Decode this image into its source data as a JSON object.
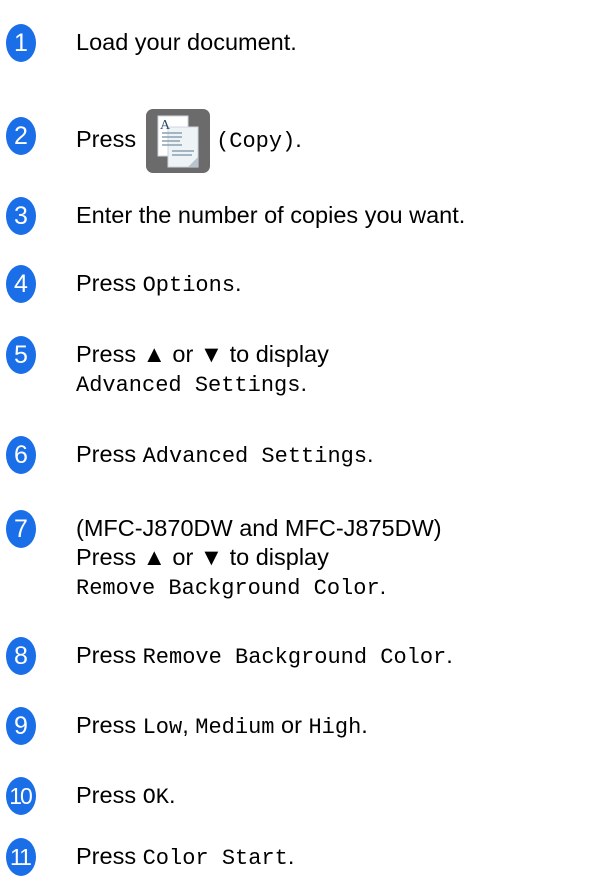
{
  "steps": [
    {
      "num": "1",
      "text": "Load your document."
    },
    {
      "num": "2",
      "text_before": "Press",
      "icon_label": "A",
      "code": "(Copy)",
      "text_after": "."
    },
    {
      "num": "3",
      "text": "Enter the number of copies you want."
    },
    {
      "num": "4",
      "text_before": "Press",
      "code": "Options",
      "text_after": "."
    },
    {
      "num": "5",
      "line1": "Press ▲ or ▼ to display",
      "code": "Advanced Settings",
      "text_after": "."
    },
    {
      "num": "6",
      "text_before": "Press",
      "code": "Advanced Settings",
      "text_after": "."
    },
    {
      "num": "7",
      "line1": "(MFC-J870DW and MFC-J875DW)",
      "line2": "Press ▲ or ▼ to display",
      "code": "Remove Background Color",
      "text_after": "."
    },
    {
      "num": "8",
      "text_before": "Press",
      "code": "Remove Background Color",
      "text_after": "."
    },
    {
      "num": "9",
      "text_before": "Press",
      "code1": "Low",
      "sep1": ",",
      "code2": "Medium",
      "sep2": "or",
      "code3": "High",
      "text_after": "."
    },
    {
      "num": "10",
      "text_before": "Press",
      "code": "OK",
      "text_after": "."
    },
    {
      "num": "11",
      "text_before": "Press",
      "code": "Color Start",
      "text_after": "."
    }
  ],
  "colors": {
    "badge": "#1a6ee8",
    "icon_bg": "#6b6b6b"
  },
  "icons": {
    "copy": "copy-icon"
  }
}
